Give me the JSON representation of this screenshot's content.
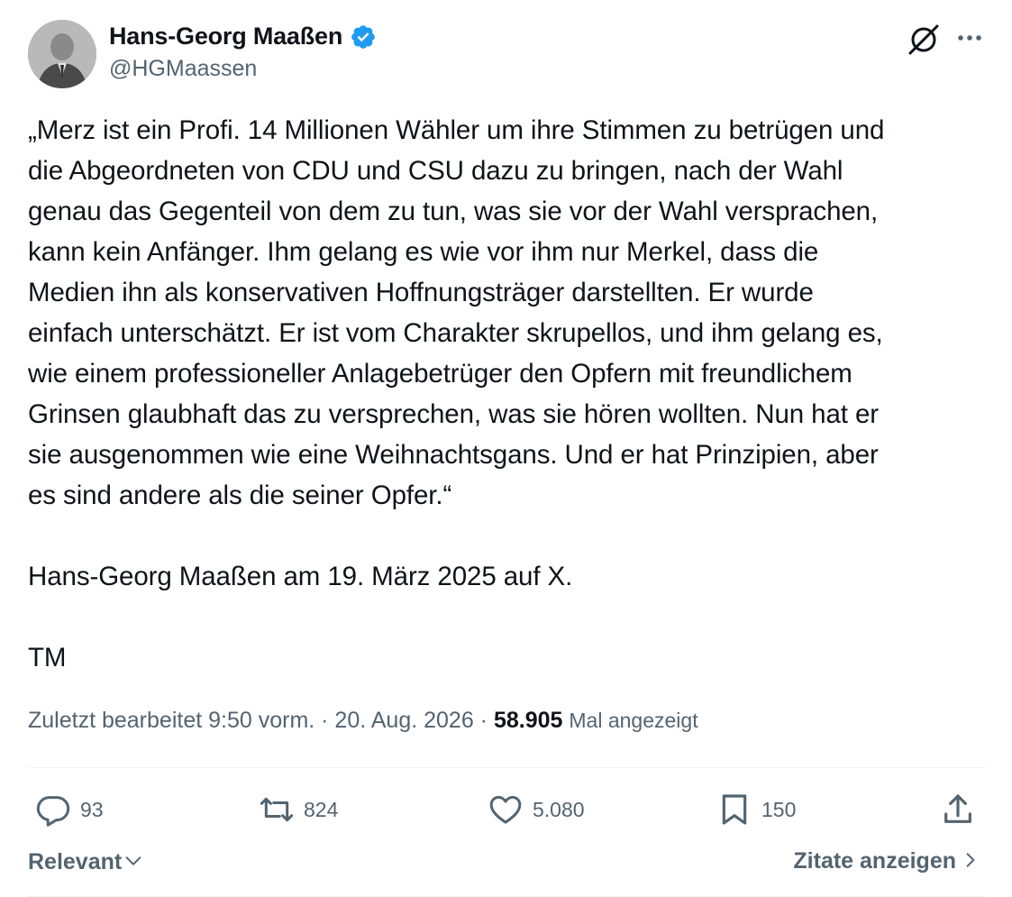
{
  "author": {
    "display_name": "Hans-Georg Maaßen",
    "handle": "@HGMaassen",
    "verified": true,
    "verified_color": "#1d9bf0"
  },
  "tweet": {
    "lines": [
      "„Merz ist ein Profi. 14 Millionen Wähler um ihre Stimmen zu betrügen und",
      "die Abgeordneten von CDU und CSU dazu zu bringen, nach der Wahl",
      "genau das Gegenteil von dem zu tun, was sie vor der Wahl versprachen,",
      "kann kein Anfänger. Ihm gelang es wie vor ihm nur Merkel, dass die",
      "Medien ihn als konservativen Hoffnungsträger darstellten. Er wurde",
      "einfach unterschätzt. Er ist vom Charakter skrupellos, und ihm gelang es,",
      "wie einem professioneller Anlagebetrüger den Opfern mit freundlichem",
      "Grinsen glaubhaft das zu versprechen, was sie hören wollten. Nun hat er",
      "sie ausgenommen wie eine Weihnachtsgans. Und er hat Prinzipien, aber",
      "es sind andere als die seiner Opfer.“"
    ],
    "attribution": "Hans-Georg Maaßen am 19. März 2025 auf X.",
    "signature": "TM"
  },
  "meta": {
    "edited_label": "Zuletzt bearbeitet 9:50 vorm. · 20. Aug. 2026 ·",
    "views_count": "58.905",
    "views_label": "Mal angezeigt"
  },
  "actions": {
    "replies": "93",
    "reposts": "824",
    "likes": "5.080",
    "bookmarks": "150"
  },
  "footer": {
    "sort_label": "Relevant",
    "quotes_label": "Zitate anzeigen"
  },
  "icons": {
    "avatar": "avatar-photo",
    "verified": "verified-badge-icon",
    "grok": "grok-icon",
    "more": "more-icon",
    "reply": "reply-icon",
    "repost": "repost-icon",
    "like": "heart-icon",
    "bookmark": "bookmark-icon",
    "share": "share-icon"
  }
}
